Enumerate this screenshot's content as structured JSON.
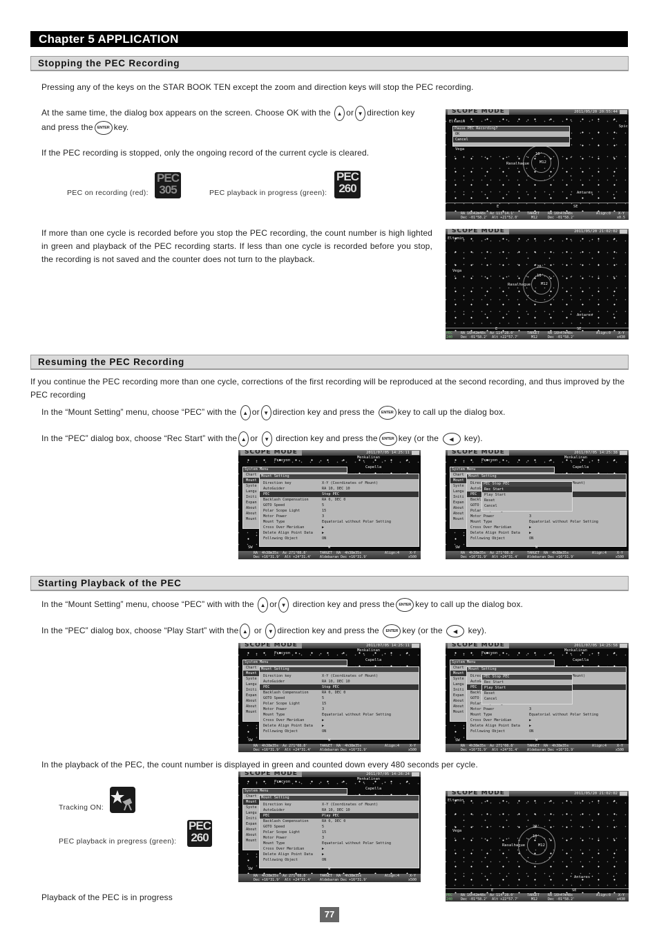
{
  "chapter": {
    "title": "Chapter 5  APPLICATION"
  },
  "keys": {
    "up": "▲",
    "down": "▼",
    "enter": "ENTER",
    "left": "◀"
  },
  "section1": {
    "heading": "Stopping the PEC Recording",
    "p1": "Pressing any of the keys on the STAR BOOK TEN except the zoom and direction keys will stop the PEC recording.",
    "p2a": "At the same time, the dialog box appears on the screen.  Choose OK with the",
    "p2or": "or",
    "p2b": "direction key",
    "p2c": "and press the",
    "p2d": "key.",
    "p3": "If the PEC recording is stopped, only the ongoing record of the current cycle is cleared.",
    "icon_rec_label": "PEC on recording (red):",
    "icon_rec": {
      "top": "PEC",
      "bottom": "305"
    },
    "icon_play_label": "PEC playback in progress (green):",
    "icon_play": {
      "top": "PEC",
      "bottom": "260"
    },
    "p4": "If more than one cycle is recorded before you stop the PEC recording, the count number is high lighted in green and playback of the PEC recording starts.  If less than one cycle is recorded before you stop, the recording is not saved and the counter does not turn to the playback."
  },
  "section2": {
    "heading": "Resuming the PEC Recording",
    "p1": "If you continue the PEC recording more than one cycle, corrections of the first recording will be reproduced at the second recording, and thus improved by the PEC recording",
    "s1a": "In the “Mount Setting” menu, choose “PEC” with the",
    "s1or": "or",
    "s1b": "direction key and press the",
    "s1c": "key to call up the dialog box.",
    "s2a": "In the “PEC” dialog box, choose “Rec Start” with the",
    "s2or": "or",
    "s2b": "direction key and press the",
    "s2c": "key (or the",
    "s2d": "key)."
  },
  "section3": {
    "heading": "Starting Playback of the PEC",
    "s1a": "In the “Mount Setting” menu, choose “PEC” with with the",
    "s1or": "or",
    "s1b": "direction key and press the",
    "s1c": "key to call up the dialog box.",
    "s2a": "In the “PEC” dialog box, choose “Play Start” with the",
    "s2or": "or",
    "s2b": "direction key and press the",
    "s2c": "key (or the",
    "s2d": "key).",
    "p3": "In the playback of the PEC, the count number is displayed in green and counted down every 480 seconds per cycle.",
    "tracking_label": "Tracking ON:",
    "play_label": "PEC playback in pregress (green):",
    "icon_play": {
      "top": "PEC",
      "bottom": "260"
    },
    "caption": "Playback of the PEC is in progress"
  },
  "screens": {
    "mode_label": "SCOPE MODE",
    "s1": {
      "datetime": "2011/05/20 20:55:44",
      "dialog_title": "Pause PEC Recording?",
      "options": [
        "OK",
        "Cancel"
      ],
      "selected": 1,
      "labels": {
        "eltamin": "Eltamin",
        "vega": "Vega",
        "rasalhague": "Rasalhague",
        "m12": "M12",
        "antares": "Antares",
        "ring": "10'",
        "e": "E",
        "se": "SE",
        "spica": "Spic"
      },
      "status": {
        "ra": "RA 16h42m48s  Az 113°14.1'",
        "dec": "Dec -01°58.2'  Alt +21°52.0'",
        "target": "TARGET",
        "tname": "M12",
        "tra": "RA 16h47m48s",
        "tdec": "Dec -01°58.2'",
        "align": "Align:0",
        "xy": "X-Y",
        "zoom": "x0.5"
      }
    },
    "s2": {
      "datetime": "2011/05/20 21:02:02",
      "labels": {
        "eltamin": "Eltamin",
        "vega": "Vega",
        "rasalhague": "Rasalhague",
        "m12": "M12",
        "antares": "Antares",
        "ring1": "20'",
        "ring2": "10'",
        "e": "E",
        "se": "SE"
      },
      "pec": {
        "top": "PEC",
        "bottom": "240"
      },
      "status": {
        "ra": "RA 16h42m48s  Az 114°28.0'",
        "dec": "Dec -01°58.2'  Alt +22°57.7'",
        "target": "TARGET",
        "tname": "M12",
        "tra": "RA 16h47m48s",
        "tdec": "Dec -01°58.2'",
        "align": "Align:0",
        "xy": "X-Y",
        "zoom": "x430"
      }
    },
    "menu": {
      "system_menu": "System Menu",
      "system_items": [
        "Chart",
        "Mount",
        "Syste",
        "Langu",
        "Initi",
        "Expan",
        "About",
        "About",
        "Mount"
      ],
      "mount_title": "Mount Setting",
      "rows": [
        {
          "k": "Direction key",
          "v": "X-Y (Coordinates of Mount)"
        },
        {
          "k": "AutoGuider",
          "v": "RA 10, DEC 10"
        },
        {
          "k": "PEC",
          "v": "Stop PEC"
        },
        {
          "k": "Backlash Compensation",
          "v": "RA 0, DEC 0"
        },
        {
          "k": "GOTO Speed",
          "v": "5"
        },
        {
          "k": "Polar Scope Light",
          "v": "15"
        },
        {
          "k": "Motor Power",
          "v": "3"
        },
        {
          "k": "Mount Type",
          "v": "Equatorial without Polar Setting"
        },
        {
          "k": "Cross Over Meridian",
          "v": "▶"
        },
        {
          "k": "Delete Align Point Data",
          "v": "▶"
        },
        {
          "k": "Following Object",
          "v": "ON"
        }
      ],
      "pec_value_play": "Play PEC",
      "pec_dialog_title": "PEC   Stop PEC",
      "pec_options": [
        "Rec Start",
        "Play Start",
        "Reset",
        "Cancel"
      ],
      "labels": {
        "procyon": "Procyon",
        "menkalinan": "Menkalinan",
        "capella": "Capella",
        "sw": "SW",
        "w": "W"
      },
      "status": {
        "ra": "RA  4h38m35s  Az 271°08.8'",
        "dec": "Dec +16°31.9'  Alt +24°31.4'",
        "target": "TARGET  RA  4h38m35s",
        "tname": "Aldebaran Dec +16°31.9'",
        "align": "Align:4",
        "xy": "X-Y",
        "zoom": "x500"
      }
    },
    "s3": {
      "datetime": "2011/07/05 14:25:11"
    },
    "s4": {
      "datetime": "2011/07/05 14:25:38",
      "selected": 0
    },
    "s5": {
      "datetime": "2011/07/05 14:25:11"
    },
    "s6": {
      "datetime": "2011/07/05 14:25:58",
      "selected": 1
    },
    "s7": {
      "datetime": "2011/07/05 14:26:24"
    },
    "s8": {
      "datetime": "2011/05/20 21:02:02"
    }
  },
  "page_number": "77"
}
